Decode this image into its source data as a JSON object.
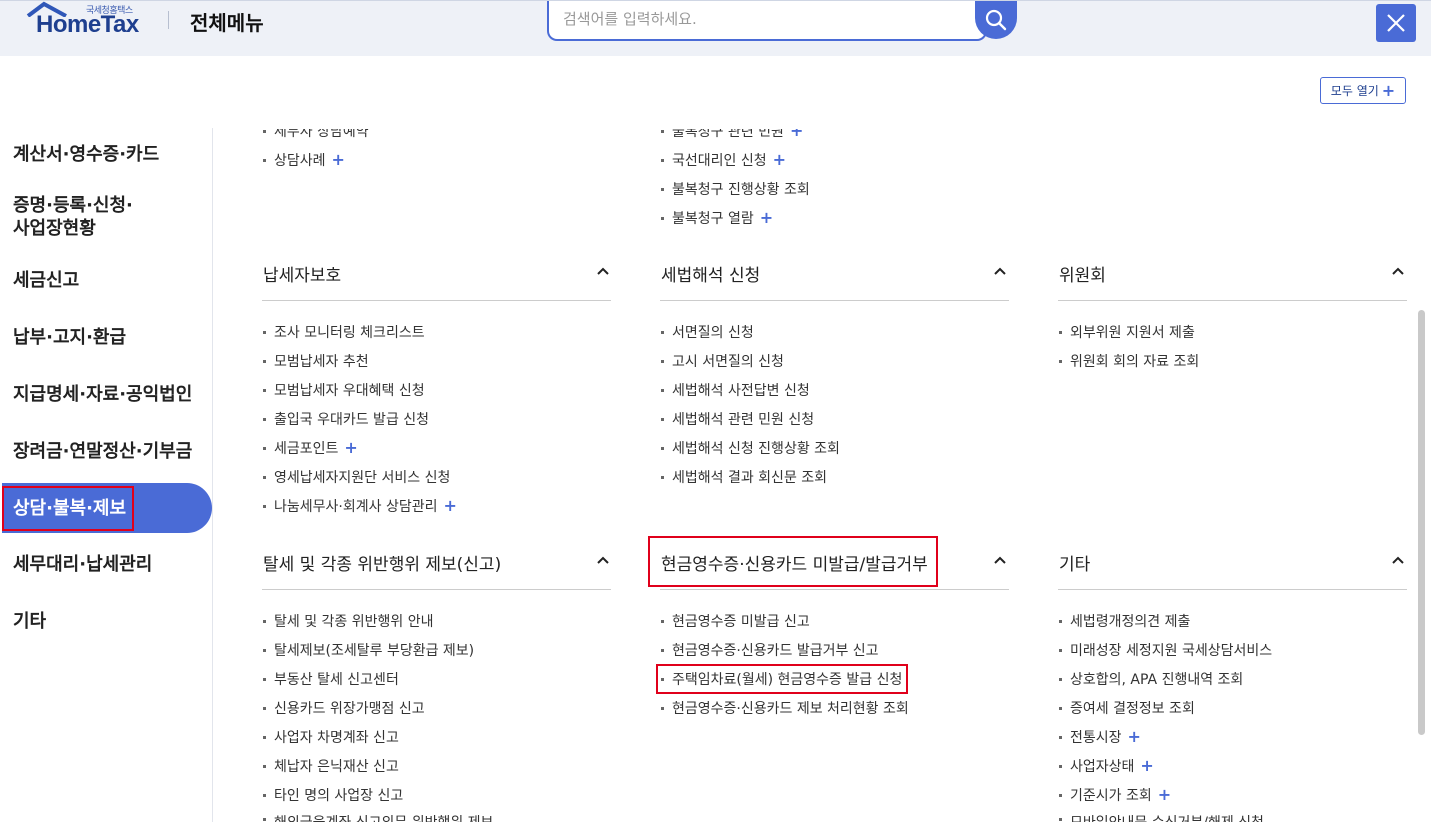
{
  "header": {
    "logo_small": "국세청홈택스",
    "logo_text": "HomeTax",
    "title": "전체메뉴",
    "search_placeholder": "검색어를 입력하세요."
  },
  "expand_all_label": "모두 열기",
  "sidebar": {
    "items": [
      "계산서·영수증·카드",
      "증명·등록·신청·",
      "사업장현황",
      "세금신고",
      "납부·고지·환급",
      "지급명세·자료·공익법인",
      "장려금·연말정산·기부금",
      "상담·불복·제보",
      "세무대리·납세관리",
      "기타"
    ],
    "active_index": 7
  },
  "top_partial": {
    "col1": [
      "세무사 상담예약",
      "상담사례"
    ],
    "col2": [
      "불복청구 관련 민원",
      "국선대리인 신청",
      "불복청구 진행상황 조회",
      "불복청구 열람"
    ]
  },
  "sections": {
    "taxpayer_protection": {
      "title": "납세자보호",
      "items": [
        "조사 모니터링 체크리스트",
        "모범납세자 추천",
        "모범납세자 우대혜택 신청",
        "출입국 우대카드 발급 신청",
        "세금포인트",
        "영세납세자지원단 서비스 신청",
        "나눔세무사·회계사 상담관리"
      ]
    },
    "tax_interpretation": {
      "title": "세법해석 신청",
      "items": [
        "서면질의 신청",
        "고시 서면질의 신청",
        "세법해석 사전답변 신청",
        "세법해석 관련 민원 신청",
        "세법해석 신청 진행상황 조회",
        "세법해석 결과 회신문 조회"
      ]
    },
    "committee": {
      "title": "위원회",
      "items": [
        "외부위원 지원서 제출",
        "위원회 회의 자료 조회"
      ]
    },
    "tax_evasion_report": {
      "title": "탈세 및 각종 위반행위 제보(신고)",
      "items": [
        "탈세 및 각종 위반행위 안내",
        "탈세제보(조세탈루 부당환급 제보)",
        "부동산 탈세 신고센터",
        "신용카드 위장가맹점 신고",
        "사업자 차명계좌 신고",
        "체납자 은닉재산 신고",
        "타인 명의 사업장 신고",
        "해외금융계좌 신고의무 위반행위 제보"
      ]
    },
    "cash_receipt": {
      "title": "현금영수증·신용카드 미발급/발급거부",
      "items": [
        "현금영수증 미발급 신고",
        "현금영수증·신용카드 발급거부 신고",
        "주택임차료(월세) 현금영수증 발급 신청",
        "현금영수증·신용카드 제보 처리현황 조회"
      ]
    },
    "etc": {
      "title": "기타",
      "items": [
        "세법령개정의견 제출",
        "미래성장 세정지원 국세상담서비스",
        "상호합의, APA 진행내역 조회",
        "증여세 결정정보 조회",
        "전통시장",
        "사업자상태",
        "기준시가 조회",
        "모바일안내문 수신거부/해제 신청"
      ]
    }
  },
  "colors": {
    "accent": "#4a6bd6",
    "highlight_box": "#e0001b"
  }
}
